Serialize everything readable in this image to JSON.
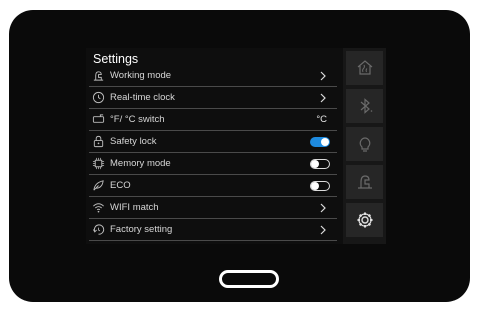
{
  "screen": {
    "title": "Settings",
    "rows": [
      {
        "label": "Working mode",
        "icon": "mode-icon",
        "control": "chevron"
      },
      {
        "label": "Real-time clock",
        "icon": "clock-icon",
        "control": "chevron"
      },
      {
        "label": "°F/ °C switch",
        "icon": "temperature-switch-icon",
        "control": "value",
        "value": "°C"
      },
      {
        "label": "Safety lock",
        "icon": "lock-icon",
        "control": "toggle",
        "state": "on"
      },
      {
        "label": "Memory mode",
        "icon": "memory-chip-icon",
        "control": "toggle",
        "state": "off"
      },
      {
        "label": "ECO",
        "icon": "leaf-icon",
        "control": "toggle",
        "state": "off"
      },
      {
        "label": "WIFI match",
        "icon": "wifi-icon",
        "control": "chevron"
      },
      {
        "label": "Factory setting",
        "icon": "reset-icon",
        "control": "chevron"
      }
    ]
  },
  "sidebar": {
    "items": [
      {
        "icon": "home-heat-icon"
      },
      {
        "icon": "bluetooth-icon"
      },
      {
        "icon": "bulb-icon"
      },
      {
        "icon": "mode-icon"
      },
      {
        "icon": "gear-icon",
        "active": true
      }
    ]
  },
  "colors": {
    "accent": "#1e8be0",
    "background": "#0e0e0e",
    "sidebar": "#171717",
    "text": "#d6d6d6"
  }
}
